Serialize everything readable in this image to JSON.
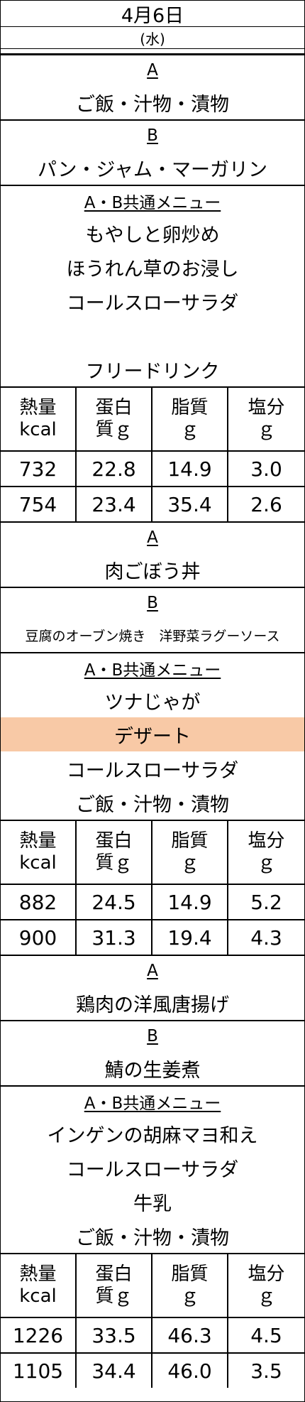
{
  "header": {
    "date": "4月6日",
    "day": "(水)"
  },
  "meals": [
    {
      "a_label": "A",
      "a_dish": "ご飯・汁物・漬物",
      "b_label": "B",
      "b_dish": "パン・ジャム・マーガリン",
      "common_label": "A・B共通メニュー",
      "common_items": [
        "もやしと卵炒め",
        "ほうれん草のお浸し",
        "コールスローサラダ",
        "",
        "フリードリンク"
      ],
      "nutrition_headers": [
        "熱量\nkcal",
        "蛋白\n質ｇ",
        "脂質\nｇ",
        "塩分\nｇ"
      ],
      "rows": [
        [
          "732",
          "22.8",
          "14.9",
          "3.0"
        ],
        [
          "754",
          "23.4",
          "35.4",
          "2.6"
        ]
      ]
    },
    {
      "a_label": "A",
      "a_dish": "肉ごぼう丼",
      "b_label": "B",
      "b_dish": "豆腐のオーブン焼き　洋野菜ラグーソース",
      "common_label": "A・B共通メニュー",
      "common_items": [
        "ツナじゃが",
        "デザート",
        "コールスローサラダ",
        "ご飯・汁物・漬物"
      ],
      "nutrition_headers": [
        "熱量\nkcal",
        "蛋白\n質ｇ",
        "脂質\nｇ",
        "塩分\nｇ"
      ],
      "rows": [
        [
          "882",
          "24.5",
          "14.9",
          "5.2"
        ],
        [
          "900",
          "31.3",
          "19.4",
          "4.3"
        ]
      ]
    },
    {
      "a_label": "A",
      "a_dish": "鶏肉の洋風唐揚げ",
      "b_label": "B",
      "b_dish": "鯖の生姜煮",
      "common_label": "A・B共通メニュー",
      "common_items": [
        "インゲンの胡麻マヨ和え",
        "コールスローサラダ",
        "牛乳",
        "ご飯・汁物・漬物"
      ],
      "nutrition_headers": [
        "熱量\nkcal",
        "蛋白\n質ｇ",
        "脂質\nｇ",
        "塩分\nｇ"
      ],
      "rows": [
        [
          "1226",
          "33.5",
          "46.3",
          "4.5"
        ],
        [
          "1105",
          "34.4",
          "46.0",
          "3.5"
        ]
      ]
    }
  ],
  "colors": {
    "highlight": "#f8c9a6",
    "border": "#000000"
  }
}
